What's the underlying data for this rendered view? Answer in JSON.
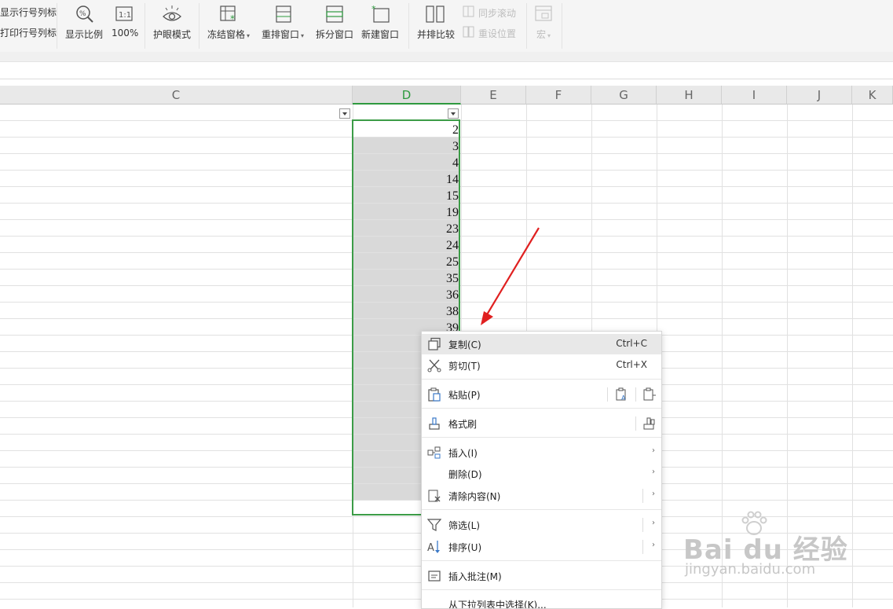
{
  "ribbon": {
    "show_row_col_label": "显示行号列标",
    "print_row_col_label": "打印行号列标",
    "zoom_label": "显示比例",
    "zoom_100_label": "100%",
    "eye_mode_label": "护眼模式",
    "freeze_label": "冻结窗格",
    "rearrange_label": "重排窗口",
    "split_label": "拆分窗口",
    "new_window_label": "新建窗口",
    "side_by_side_label": "并排比较",
    "sync_scroll_label": "同步滚动",
    "reset_pos_label": "重设位置",
    "macro_label": "宏"
  },
  "columns": [
    {
      "label": "C"
    },
    {
      "label": "D"
    },
    {
      "label": "E"
    },
    {
      "label": "F"
    },
    {
      "label": "G"
    },
    {
      "label": "H"
    },
    {
      "label": "I"
    },
    {
      "label": "J"
    },
    {
      "label": "K"
    }
  ],
  "cells_d": [
    "2",
    "3",
    "4",
    "14",
    "15",
    "19",
    "23",
    "24",
    "25",
    "35",
    "36",
    "38",
    "39"
  ],
  "context_menu": {
    "copy": {
      "label": "复制(C)",
      "shortcut": "Ctrl+C"
    },
    "cut": {
      "label": "剪切(T)",
      "shortcut": "Ctrl+X"
    },
    "paste": {
      "label": "粘贴(P)"
    },
    "format_painter": {
      "label": "格式刷"
    },
    "insert": {
      "label": "插入(I)"
    },
    "delete": {
      "label": "删除(D)"
    },
    "clear": {
      "label": "清除内容(N)"
    },
    "filter": {
      "label": "筛选(L)"
    },
    "sort": {
      "label": "排序(U)"
    },
    "insert_comment": {
      "label": "插入批注(M)"
    },
    "pick_from_list": {
      "label": "从下拉列表中选择(K)..."
    }
  },
  "watermark": {
    "brand": "Bai du 经验",
    "url": "jingyan.baidu.com"
  },
  "colors": {
    "accent_green": "#3c9c47",
    "arrow_red": "#e02020",
    "selection_fill": "#d9d9d9"
  }
}
